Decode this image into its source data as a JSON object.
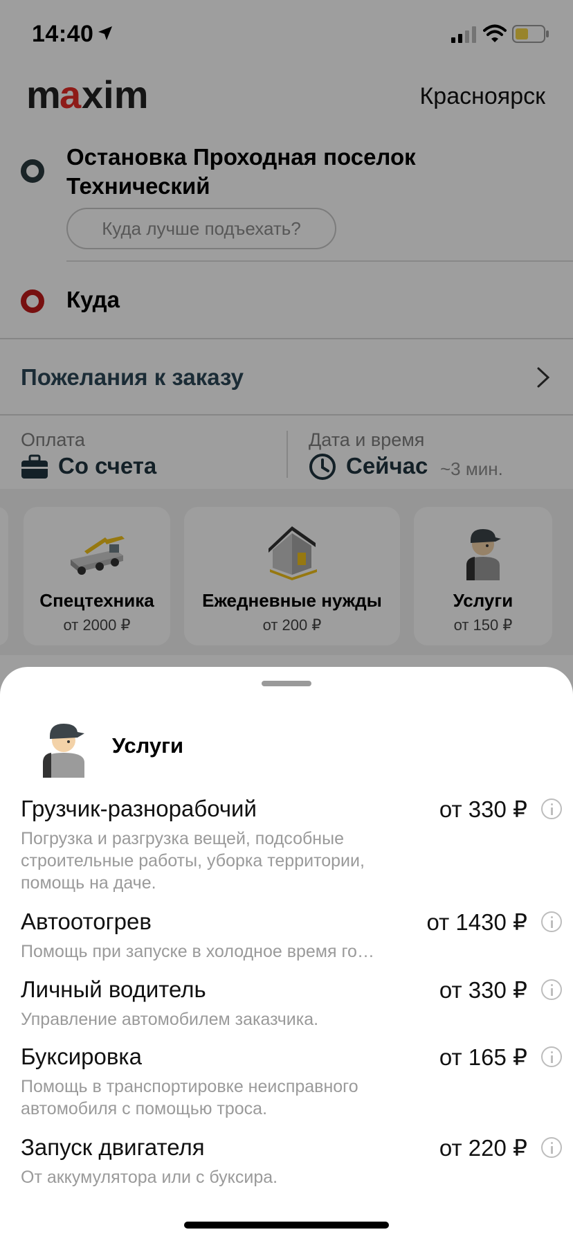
{
  "status_bar": {
    "time": "14:40"
  },
  "header": {
    "logo": "maxim",
    "city": "Красноярск"
  },
  "route": {
    "from": "Остановка Проходная поселок Технический",
    "pickup_hint": "Куда лучше подъехать?",
    "to": "Куда"
  },
  "wishes": {
    "label": "Пожелания к заказу"
  },
  "payment": {
    "label": "Оплата",
    "value": "Со счета"
  },
  "datetime": {
    "label": "Дата и время",
    "value": "Сейчас",
    "eta": "~3 мин."
  },
  "categories": [
    {
      "title": "Спецтехника",
      "price": "от 2000 ₽",
      "icon": "crane-truck-icon"
    },
    {
      "title": "Ежедневные нужды",
      "price": "от 200 ₽",
      "icon": "house-icon"
    },
    {
      "title": "Услуги",
      "price": "от 150 ₽",
      "icon": "worker-icon"
    }
  ],
  "sheet": {
    "title": "Услуги",
    "services": [
      {
        "name": "Грузчик-разнорабочий",
        "price": "от 330 ₽",
        "description": "Погрузка и разгрузка вещей, подсобные строительные работы, уборка территории, помощь на даче."
      },
      {
        "name": "Автоотогрев",
        "price": "от 1430 ₽",
        "description": "Помощь при запуске в холодное время го…"
      },
      {
        "name": "Личный водитель",
        "price": "от 330 ₽",
        "description": "Управление автомобилем заказчика."
      },
      {
        "name": "Буксировка",
        "price": "от 165 ₽",
        "description": "Помощь в транспортировке неисправного автомобиля с помощью троса."
      },
      {
        "name": "Запуск двигателя",
        "price": "от 220 ₽",
        "description": "От аккумулятора или с буксира."
      }
    ]
  },
  "colors": {
    "brand_red": "#e52d27",
    "logo_dark": "#222222",
    "accent_blue": "#2c4858"
  }
}
